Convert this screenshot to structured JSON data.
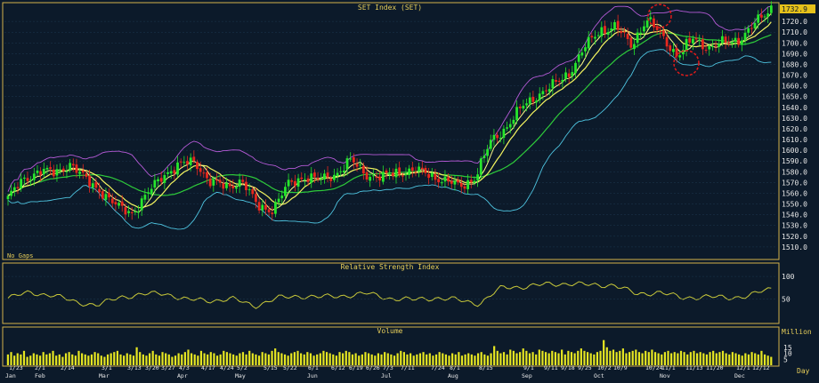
{
  "colors": {
    "background": "#0c1a2a",
    "panel_border": "#d4b24a",
    "title_text": "#e8cf5a",
    "grid": "#1d3950",
    "axis_text": "#e8e8e8",
    "candle_up": "#26e62c",
    "candle_down": "#e8281e",
    "ma_fast": "#f5f560",
    "ma_slow": "#2ecb3a",
    "bb_upper": "#b45ad6",
    "bb_lower": "#4ec4e0",
    "rsi_line": "#c9c93a",
    "volume_bar": "#e6e622",
    "last_price_bg": "#e6c21a",
    "annotation": "#e01a1a"
  },
  "price_panel": {
    "title": "SET Index (SET)",
    "corner_note": "No Gaps",
    "last_price": "1732.9"
  },
  "rsi_panel": {
    "title": "Relative Strength Index"
  },
  "volume_panel": {
    "title": "Volume",
    "unit_label": "Million"
  },
  "x_axis": {
    "unit_label": "Day",
    "day_labels": [
      "1/23",
      "2/1",
      "2/14",
      "3/1",
      "3/13",
      "3/20",
      "3/27",
      "4/3",
      "4/17",
      "4/24",
      "5/2",
      "5/15",
      "5/22",
      "6/1",
      "6/12",
      "6/19",
      "6/26",
      "7/3",
      "7/11",
      "7/24",
      "8/1",
      "8/15",
      "9/1",
      "9/11",
      "9/18",
      "9/25",
      "10/2",
      "10/9",
      "10/24",
      "11/1",
      "11/13",
      "11/20",
      "12/1",
      "12/12"
    ],
    "month_labels": [
      "Jan",
      "Feb",
      "Mar",
      "Apr",
      "May",
      "Jun",
      "Jul",
      "Aug",
      "Sep",
      "Oct",
      "Nov",
      "Dec"
    ]
  },
  "chart_data": [
    {
      "type": "candlestick",
      "title": "SET Index (SET)",
      "ylim": [
        1500,
        1735
      ],
      "y_ticks": [
        1510,
        1520,
        1530,
        1540,
        1550,
        1560,
        1570,
        1580,
        1590,
        1600,
        1610,
        1620,
        1630,
        1640,
        1650,
        1660,
        1670,
        1680,
        1690,
        1700,
        1710,
        1720
      ],
      "close_series": [
        {
          "x": "1/23",
          "y": 1556
        },
        {
          "x": "1/27",
          "y": 1572
        },
        {
          "x": "2/1",
          "y": 1582
        },
        {
          "x": "2/8",
          "y": 1578
        },
        {
          "x": "2/14",
          "y": 1588
        },
        {
          "x": "2/21",
          "y": 1572
        },
        {
          "x": "3/1",
          "y": 1562
        },
        {
          "x": "3/8",
          "y": 1547
        },
        {
          "x": "3/13",
          "y": 1542
        },
        {
          "x": "3/20",
          "y": 1560
        },
        {
          "x": "3/27",
          "y": 1578
        },
        {
          "x": "4/3",
          "y": 1586
        },
        {
          "x": "4/10",
          "y": 1590
        },
        {
          "x": "4/17",
          "y": 1570
        },
        {
          "x": "4/24",
          "y": 1566
        },
        {
          "x": "5/2",
          "y": 1572
        },
        {
          "x": "5/10",
          "y": 1548
        },
        {
          "x": "5/15",
          "y": 1545
        },
        {
          "x": "5/22",
          "y": 1568
        },
        {
          "x": "6/1",
          "y": 1576
        },
        {
          "x": "6/12",
          "y": 1572
        },
        {
          "x": "6/19",
          "y": 1578
        },
        {
          "x": "6/26",
          "y": 1590
        },
        {
          "x": "7/3",
          "y": 1578
        },
        {
          "x": "7/11",
          "y": 1574
        },
        {
          "x": "7/17",
          "y": 1580
        },
        {
          "x": "7/24",
          "y": 1581
        },
        {
          "x": "8/1",
          "y": 1578
        },
        {
          "x": "8/8",
          "y": 1572
        },
        {
          "x": "8/15",
          "y": 1566
        },
        {
          "x": "8/25",
          "y": 1575
        },
        {
          "x": "9/1",
          "y": 1608
        },
        {
          "x": "9/5",
          "y": 1622
        },
        {
          "x": "9/11",
          "y": 1640
        },
        {
          "x": "9/18",
          "y": 1652
        },
        {
          "x": "9/25",
          "y": 1660
        },
        {
          "x": "10/2",
          "y": 1672
        },
        {
          "x": "10/6",
          "y": 1695
        },
        {
          "x": "10/9",
          "y": 1712
        },
        {
          "x": "10/17",
          "y": 1715
        },
        {
          "x": "10/24",
          "y": 1698
        },
        {
          "x": "11/1",
          "y": 1722
        },
        {
          "x": "11/8",
          "y": 1706
        },
        {
          "x": "11/13",
          "y": 1688
        },
        {
          "x": "11/20",
          "y": 1704
        },
        {
          "x": "11/27",
          "y": 1696
        },
        {
          "x": "12/1",
          "y": 1700
        },
        {
          "x": "12/7",
          "y": 1704
        },
        {
          "x": "12/12",
          "y": 1718
        },
        {
          "x": "12/18",
          "y": 1733
        }
      ],
      "series": [
        {
          "name": "Moving average (short)",
          "style": "yellow line"
        },
        {
          "name": "Moving average (long)",
          "style": "green line"
        },
        {
          "name": "Bollinger upper",
          "style": "purple line"
        },
        {
          "name": "Bollinger lower",
          "style": "cyan line"
        }
      ],
      "annotations": [
        "red dashed circle near 11/1 high",
        "red dashed circle near 11/13 low"
      ]
    },
    {
      "type": "line",
      "title": "Relative Strength Index",
      "ylim": [
        0,
        110
      ],
      "y_ticks": [
        50,
        100
      ],
      "series": [
        {
          "name": "RSI",
          "points": [
            {
              "x": "1/23",
              "y": 52
            },
            {
              "x": "2/1",
              "y": 65
            },
            {
              "x": "2/14",
              "y": 58
            },
            {
              "x": "3/1",
              "y": 44
            },
            {
              "x": "3/13",
              "y": 36
            },
            {
              "x": "3/20",
              "y": 55
            },
            {
              "x": "3/27",
              "y": 60
            },
            {
              "x": "4/3",
              "y": 63
            },
            {
              "x": "4/17",
              "y": 48
            },
            {
              "x": "4/24",
              "y": 47
            },
            {
              "x": "5/2",
              "y": 50
            },
            {
              "x": "5/15",
              "y": 35
            },
            {
              "x": "5/22",
              "y": 52
            },
            {
              "x": "6/1",
              "y": 57
            },
            {
              "x": "6/12",
              "y": 54
            },
            {
              "x": "6/19",
              "y": 58
            },
            {
              "x": "6/26",
              "y": 62
            },
            {
              "x": "7/3",
              "y": 52
            },
            {
              "x": "7/11",
              "y": 48
            },
            {
              "x": "7/24",
              "y": 53
            },
            {
              "x": "8/1",
              "y": 48
            },
            {
              "x": "8/15",
              "y": 40
            },
            {
              "x": "9/1",
              "y": 75
            },
            {
              "x": "9/11",
              "y": 78
            },
            {
              "x": "9/18",
              "y": 82
            },
            {
              "x": "9/25",
              "y": 85
            },
            {
              "x": "10/2",
              "y": 80
            },
            {
              "x": "10/9",
              "y": 82
            },
            {
              "x": "10/24",
              "y": 60
            },
            {
              "x": "11/1",
              "y": 66
            },
            {
              "x": "11/13",
              "y": 52
            },
            {
              "x": "11/20",
              "y": 56
            },
            {
              "x": "12/1",
              "y": 52
            },
            {
              "x": "12/12",
              "y": 58
            },
            {
              "x": "12/18",
              "y": 72
            }
          ]
        }
      ]
    },
    {
      "type": "bar",
      "title": "Volume",
      "ylim": [
        0,
        23
      ],
      "y_ticks": [
        5,
        10,
        15
      ],
      "series": [
        {
          "name": "Volume",
          "values": [
            9,
            11,
            8,
            10,
            9,
            12,
            7,
            8,
            10,
            9,
            8,
            11,
            9,
            10,
            12,
            8,
            9,
            7,
            10,
            11,
            9,
            8,
            12,
            10,
            9,
            8,
            9,
            11,
            10,
            8,
            7,
            9,
            10,
            11,
            12,
            9,
            8,
            10,
            9,
            8,
            15,
            11,
            9,
            8,
            10,
            12,
            9,
            8,
            11,
            10,
            9,
            7,
            8,
            10,
            9,
            11,
            13,
            10,
            9,
            8,
            12,
            10,
            9,
            11,
            10,
            8,
            9,
            12,
            11,
            10,
            9,
            8,
            10,
            11,
            9,
            12,
            10,
            9,
            8,
            11,
            10,
            9,
            12,
            14,
            11,
            10,
            9,
            8,
            10,
            11,
            12,
            10,
            9,
            11,
            10,
            8,
            9,
            10,
            12,
            11,
            10,
            9,
            8,
            11,
            10,
            12,
            11,
            9,
            10,
            8,
            9,
            11,
            10,
            9,
            8,
            10,
            9,
            11,
            10,
            9,
            8,
            10,
            12,
            11,
            9,
            10,
            8,
            9,
            10,
            11,
            9,
            10,
            8,
            9,
            11,
            10,
            9,
            8,
            10,
            9,
            11,
            8,
            9,
            10,
            9,
            8,
            10,
            11,
            9,
            8,
            10,
            16,
            12,
            10,
            11,
            9,
            13,
            12,
            10,
            11,
            14,
            12,
            10,
            11,
            9,
            13,
            12,
            11,
            10,
            12,
            11,
            10,
            13,
            9,
            12,
            11,
            10,
            12,
            14,
            12,
            11,
            10,
            9,
            11,
            12,
            21,
            15,
            12,
            13,
            11,
            12,
            14,
            10,
            11,
            12,
            13,
            11,
            10,
            12,
            11,
            13,
            11,
            10,
            9,
            11,
            12,
            10,
            11,
            10,
            12,
            11,
            9,
            11,
            12,
            10,
            11,
            10,
            9,
            11,
            12,
            10,
            11,
            12,
            10,
            9,
            11,
            10,
            9,
            8,
            10,
            9,
            11,
            10,
            9,
            12,
            9,
            8,
            7
          ]
        }
      ]
    }
  ]
}
